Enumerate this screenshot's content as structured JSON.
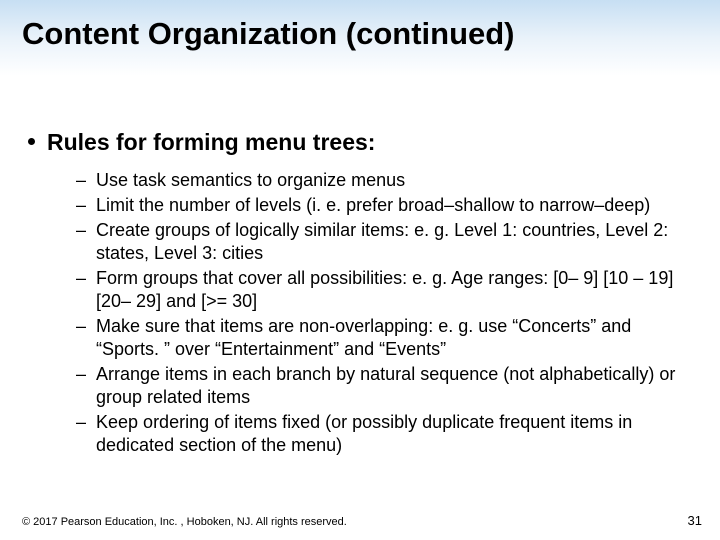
{
  "title": "Content Organization (continued)",
  "topline": "Rules for forming menu trees:",
  "sub": {
    "i0": "Use task semantics to organize menus",
    "i1": "Limit the number of levels (i. e. prefer broad–shallow to narrow–deep)",
    "i2": "Create groups of logically similar items: e. g. Level 1: countries, Level 2: states, Level 3: cities",
    "i3": "Form groups that cover all possibilities:  e. g. Age ranges: [0– 9] [10 – 19] [20– 29] and [>= 30]",
    "i4": "Make sure that items are non-overlapping: e. g. use “Concerts” and “Sports. ” over “Entertainment” and “Events”",
    "i5": "Arrange items in each branch by natural sequence (not alphabetically) or group related items",
    "i6": "Keep ordering of items fixed (or possibly duplicate frequent items in dedicated section of the menu)"
  },
  "footer": "© 2017 Pearson Education, Inc. , Hoboken, NJ.  All rights reserved.",
  "page": "31"
}
